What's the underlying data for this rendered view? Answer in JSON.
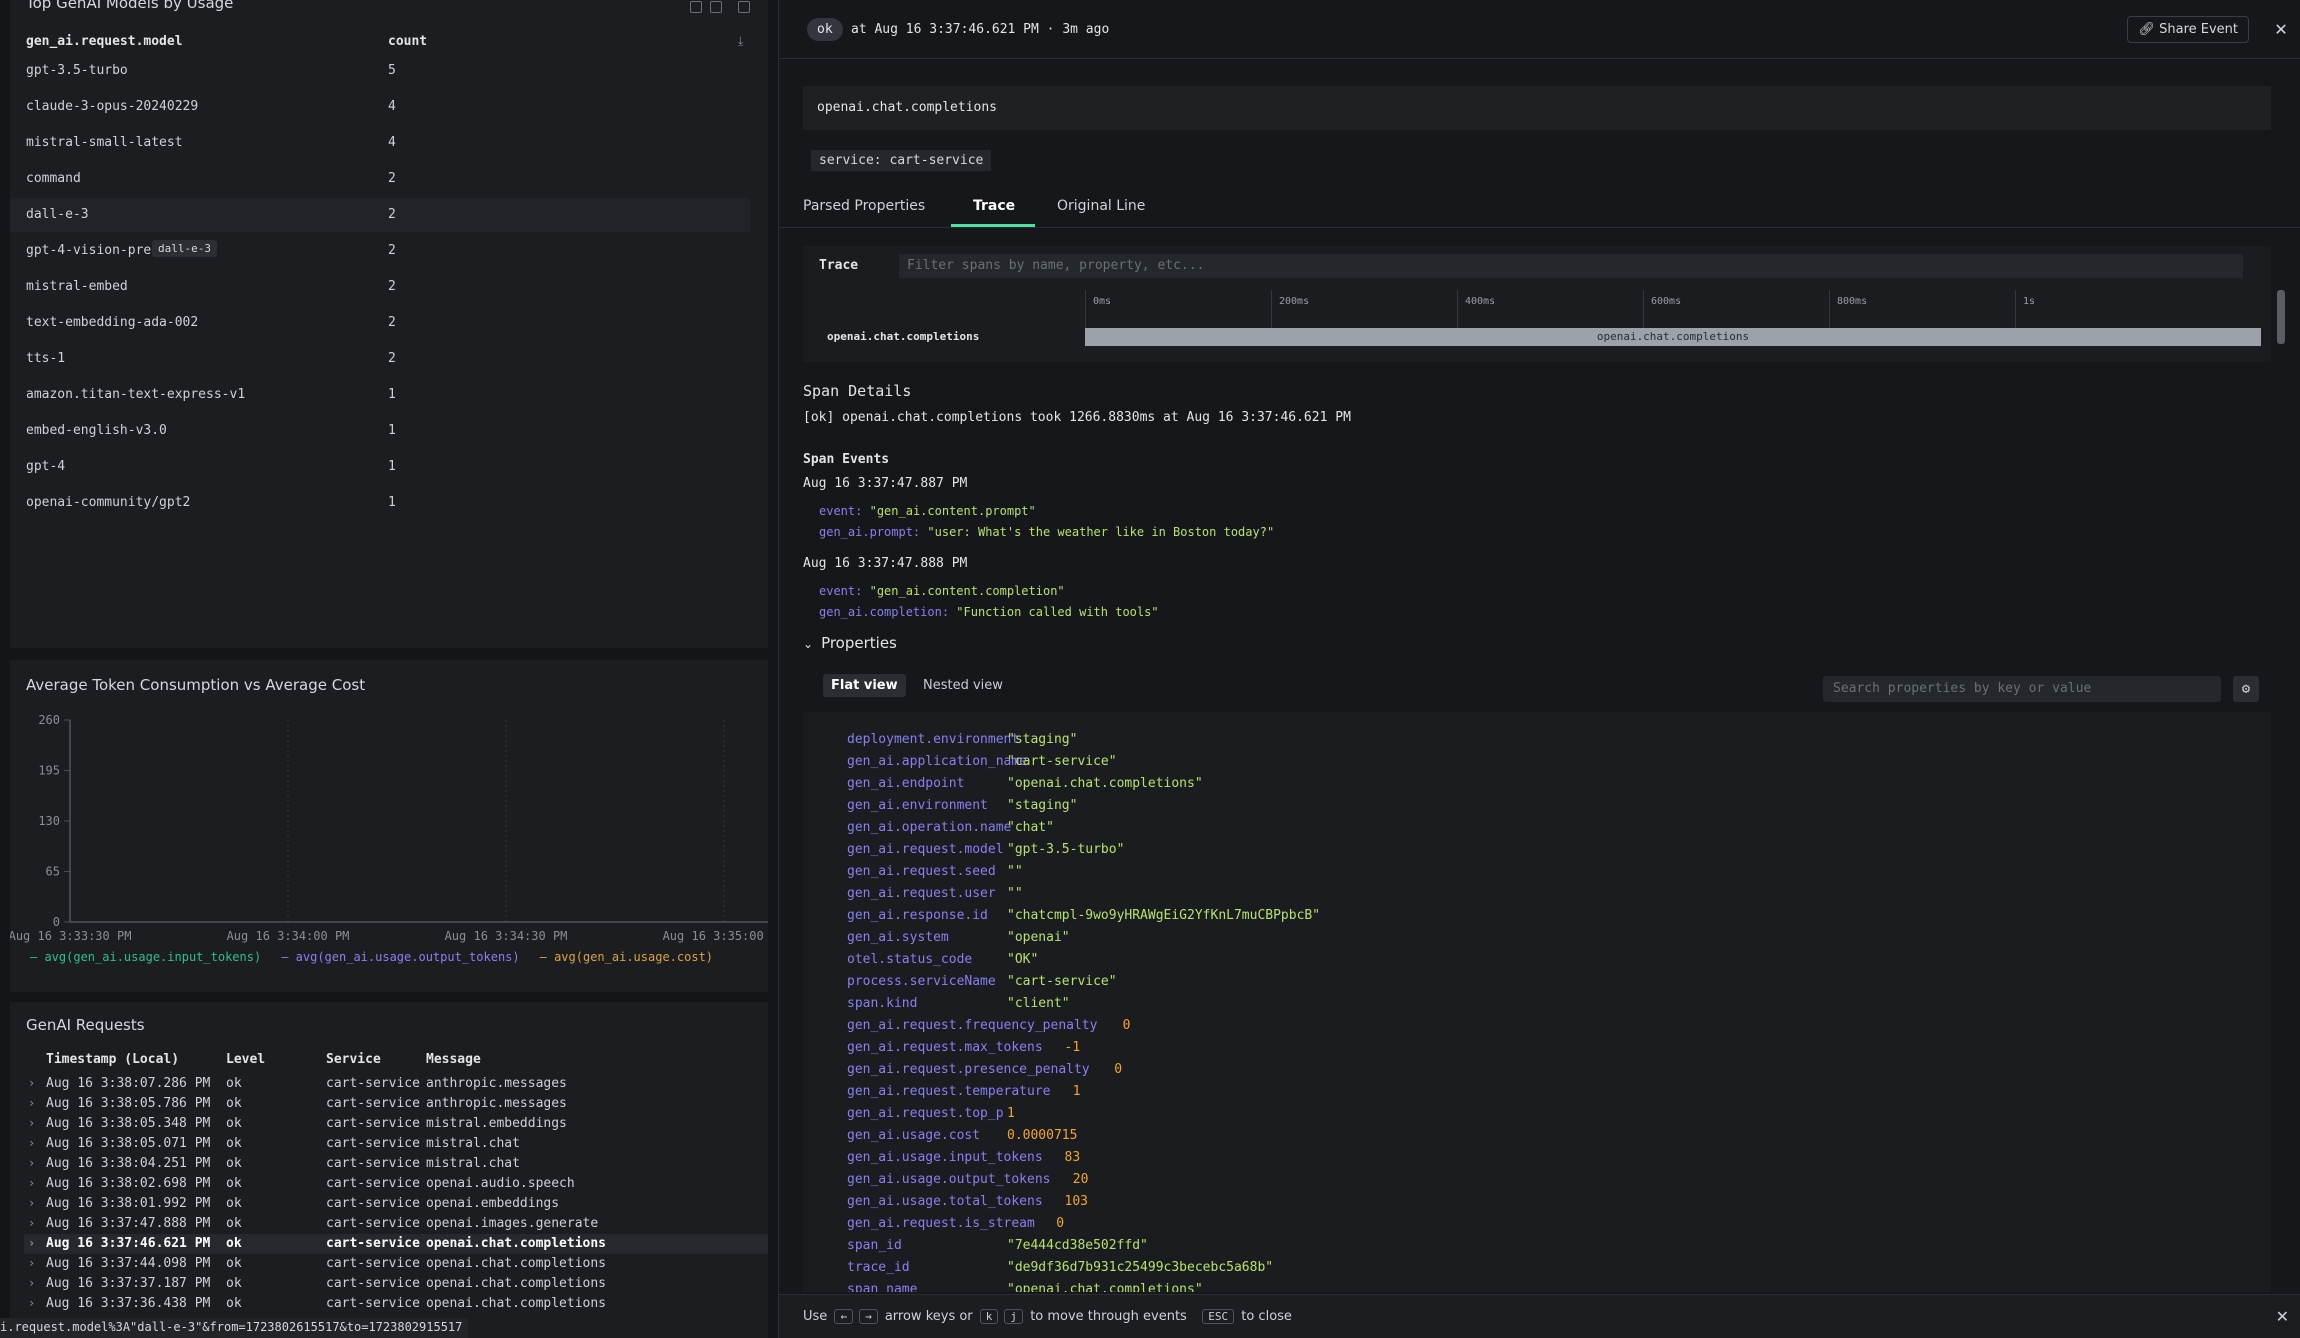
{
  "left": {
    "models_panel": {
      "title": "Top GenAI Models by Usage",
      "col_model": "gen_ai.request.model",
      "col_count": "count",
      "tooltip": "dall-e-3",
      "rows": [
        {
          "model": "gpt-3.5-turbo",
          "count": "5"
        },
        {
          "model": "claude-3-opus-20240229",
          "count": "4"
        },
        {
          "model": "mistral-small-latest",
          "count": "4"
        },
        {
          "model": "command",
          "count": "2"
        },
        {
          "model": "dall-e-3",
          "count": "2"
        },
        {
          "model": "gpt-4-vision-prev",
          "count": "2"
        },
        {
          "model": "mistral-embed",
          "count": "2"
        },
        {
          "model": "text-embedding-ada-002",
          "count": "2"
        },
        {
          "model": "tts-1",
          "count": "2"
        },
        {
          "model": "amazon.titan-text-express-v1",
          "count": "1"
        },
        {
          "model": "embed-english-v3.0",
          "count": "1"
        },
        {
          "model": "gpt-4",
          "count": "1"
        },
        {
          "model": "openai-community/gpt2",
          "count": "1"
        }
      ]
    },
    "chart_panel": {
      "title": "Average Token Consumption vs Average Cost"
    },
    "requests_panel": {
      "title": "GenAI Requests",
      "cols": [
        "Timestamp (Local)",
        "Level",
        "Service",
        "Message"
      ],
      "rows": [
        {
          "ts": "Aug 16 3:38:07.286 PM",
          "level": "ok",
          "service": "cart-service",
          "msg": "anthropic.messages"
        },
        {
          "ts": "Aug 16 3:38:05.786 PM",
          "level": "ok",
          "service": "cart-service",
          "msg": "anthropic.messages"
        },
        {
          "ts": "Aug 16 3:38:05.348 PM",
          "level": "ok",
          "service": "cart-service",
          "msg": "mistral.embeddings"
        },
        {
          "ts": "Aug 16 3:38:05.071 PM",
          "level": "ok",
          "service": "cart-service",
          "msg": "mistral.chat"
        },
        {
          "ts": "Aug 16 3:38:04.251 PM",
          "level": "ok",
          "service": "cart-service",
          "msg": "mistral.chat"
        },
        {
          "ts": "Aug 16 3:38:02.698 PM",
          "level": "ok",
          "service": "cart-service",
          "msg": "openai.audio.speech"
        },
        {
          "ts": "Aug 16 3:38:01.992 PM",
          "level": "ok",
          "service": "cart-service",
          "msg": "openai.embeddings"
        },
        {
          "ts": "Aug 16 3:37:47.888 PM",
          "level": "ok",
          "service": "cart-service",
          "msg": "openai.images.generate"
        },
        {
          "ts": "Aug 16 3:37:46.621 PM",
          "level": "ok",
          "service": "cart-service",
          "msg": "openai.chat.completions"
        },
        {
          "ts": "Aug 16 3:37:44.098 PM",
          "level": "ok",
          "service": "cart-service",
          "msg": "openai.chat.completions"
        },
        {
          "ts": "Aug 16 3:37:37.187 PM",
          "level": "ok",
          "service": "cart-service",
          "msg": "openai.chat.completions"
        },
        {
          "ts": "Aug 16 3:37:36.438 PM",
          "level": "ok",
          "service": "cart-service",
          "msg": "openai.chat.completions"
        }
      ],
      "selected_index": 8
    },
    "status_url": "i.request.model%3A\"dall-e-3\"&from=1723802615517&to=1723802915517"
  },
  "chart_data": {
    "type": "line",
    "title": "Average Token Consumption vs Average Cost",
    "x_ticks": [
      "Aug 16 3:33:30 PM",
      "Aug 16 3:34:00 PM",
      "Aug 16 3:34:30 PM",
      "Aug 16 3:35:00 PM"
    ],
    "y_ticks": [
      0,
      65,
      130,
      195,
      260
    ],
    "ylim": [
      0,
      260
    ],
    "grid": true,
    "legend_position": "bottom-left",
    "series": [
      {
        "name": "avg(gen_ai.usage.input_tokens)",
        "color": "#2fbf8f",
        "values": []
      },
      {
        "name": "avg(gen_ai.usage.output_tokens)",
        "color": "#8a7ff0",
        "values": []
      },
      {
        "name": "avg(gen_ai.usage.cost)",
        "color": "#d9a441",
        "values": []
      }
    ]
  },
  "right": {
    "status_badge": "ok",
    "header_time": "at Aug 16 3:37:46.621 PM · 3m ago",
    "share_label": "Share Event",
    "event_title": "openai.chat.completions",
    "service_tag": "service: cart-service",
    "tabs": [
      "Parsed Properties",
      "Trace",
      "Original Line"
    ],
    "trace": {
      "label": "Trace",
      "filter_placeholder": "Filter spans by name, property, etc...",
      "ticks": [
        "0ms",
        "200ms",
        "400ms",
        "600ms",
        "800ms",
        "1s"
      ],
      "span_name": "openai.chat.completions",
      "bar_label": "openai.chat.completions",
      "bar_fraction": 0.95
    },
    "span_details": {
      "title": "Span Details",
      "summary_prefix": "[ok] ",
      "summary_name": "openai.chat.completions",
      "summary_took": " took ",
      "summary_ms": "1266.8830ms",
      "summary_at": " at ",
      "summary_time": "Aug 16 3:37:46.621 PM"
    },
    "span_events": {
      "title": "Span Events",
      "groups": [
        {
          "time": "Aug 16 3:37:47.887 PM",
          "lines": [
            {
              "k": "event:",
              "v": "\"gen_ai.content.prompt\""
            },
            {
              "k": "gen_ai.prompt:",
              "v": "\"user: What's the weather like in Boston today?\""
            }
          ]
        },
        {
          "time": "Aug 16 3:37:47.888 PM",
          "lines": [
            {
              "k": "event:",
              "v": "\"gen_ai.content.completion\""
            },
            {
              "k": "gen_ai.completion:",
              "v": "\"Function called with tools\""
            }
          ]
        }
      ]
    },
    "properties": {
      "title": "Properties",
      "flat_label": "Flat view",
      "nested_label": "Nested view",
      "search_placeholder": "Search properties by key or value",
      "rows": [
        {
          "k": "deployment.environment",
          "v": "\"staging\"",
          "t": "str"
        },
        {
          "k": "gen_ai.application_name",
          "v": "\"cart-service\"",
          "t": "str"
        },
        {
          "k": "gen_ai.endpoint",
          "v": "\"openai.chat.completions\"",
          "t": "str"
        },
        {
          "k": "gen_ai.environment",
          "v": "\"staging\"",
          "t": "str"
        },
        {
          "k": "gen_ai.operation.name",
          "v": "\"chat\"",
          "t": "str"
        },
        {
          "k": "gen_ai.request.model",
          "v": "\"gpt-3.5-turbo\"",
          "t": "str"
        },
        {
          "k": "gen_ai.request.seed",
          "v": "\"\"",
          "t": "str"
        },
        {
          "k": "gen_ai.request.user",
          "v": "\"\"",
          "t": "str"
        },
        {
          "k": "gen_ai.response.id",
          "v": "\"chatcmpl-9wo9yHRAWgEiG2YfKnL7muCBPpbcB\"",
          "t": "str"
        },
        {
          "k": "gen_ai.system",
          "v": "\"openai\"",
          "t": "str"
        },
        {
          "k": "otel.status_code",
          "v": "\"OK\"",
          "t": "str"
        },
        {
          "k": "process.serviceName",
          "v": "\"cart-service\"",
          "t": "str"
        },
        {
          "k": "span.kind",
          "v": "\"client\"",
          "t": "str"
        },
        {
          "k": "gen_ai.request.frequency_penalty",
          "v": "0",
          "t": "num"
        },
        {
          "k": "gen_ai.request.max_tokens",
          "v": "-1",
          "t": "num"
        },
        {
          "k": "gen_ai.request.presence_penalty",
          "v": "0",
          "t": "num"
        },
        {
          "k": "gen_ai.request.temperature",
          "v": "1",
          "t": "num"
        },
        {
          "k": "gen_ai.request.top_p",
          "v": "1",
          "t": "num"
        },
        {
          "k": "gen_ai.usage.cost",
          "v": "0.0000715",
          "t": "num"
        },
        {
          "k": "gen_ai.usage.input_tokens",
          "v": "83",
          "t": "num"
        },
        {
          "k": "gen_ai.usage.output_tokens",
          "v": "20",
          "t": "num"
        },
        {
          "k": "gen_ai.usage.total_tokens",
          "v": "103",
          "t": "num"
        },
        {
          "k": "gen_ai.request.is_stream",
          "v": "0",
          "t": "num"
        },
        {
          "k": "span_id",
          "v": "\"7e444cd38e502ffd\"",
          "t": "str"
        },
        {
          "k": "trace_id",
          "v": "\"de9df36d7b931c25499c3becebc5a68b\"",
          "t": "str"
        },
        {
          "k": "span_name",
          "v": "\"openai.chat.completions\"",
          "t": "str"
        }
      ]
    },
    "footer": {
      "use": "Use",
      "key_left": "←",
      "key_right": "→",
      "arrow_text": "arrow keys or",
      "key_k": "k",
      "key_j": "j",
      "move_text": "to move through events",
      "key_esc": "ESC",
      "close_text": "to close"
    }
  },
  "colors": {
    "accent": "#4ee0a0",
    "key": "#8a7ff0",
    "string": "#b6e36a",
    "number": "#f5a623"
  }
}
